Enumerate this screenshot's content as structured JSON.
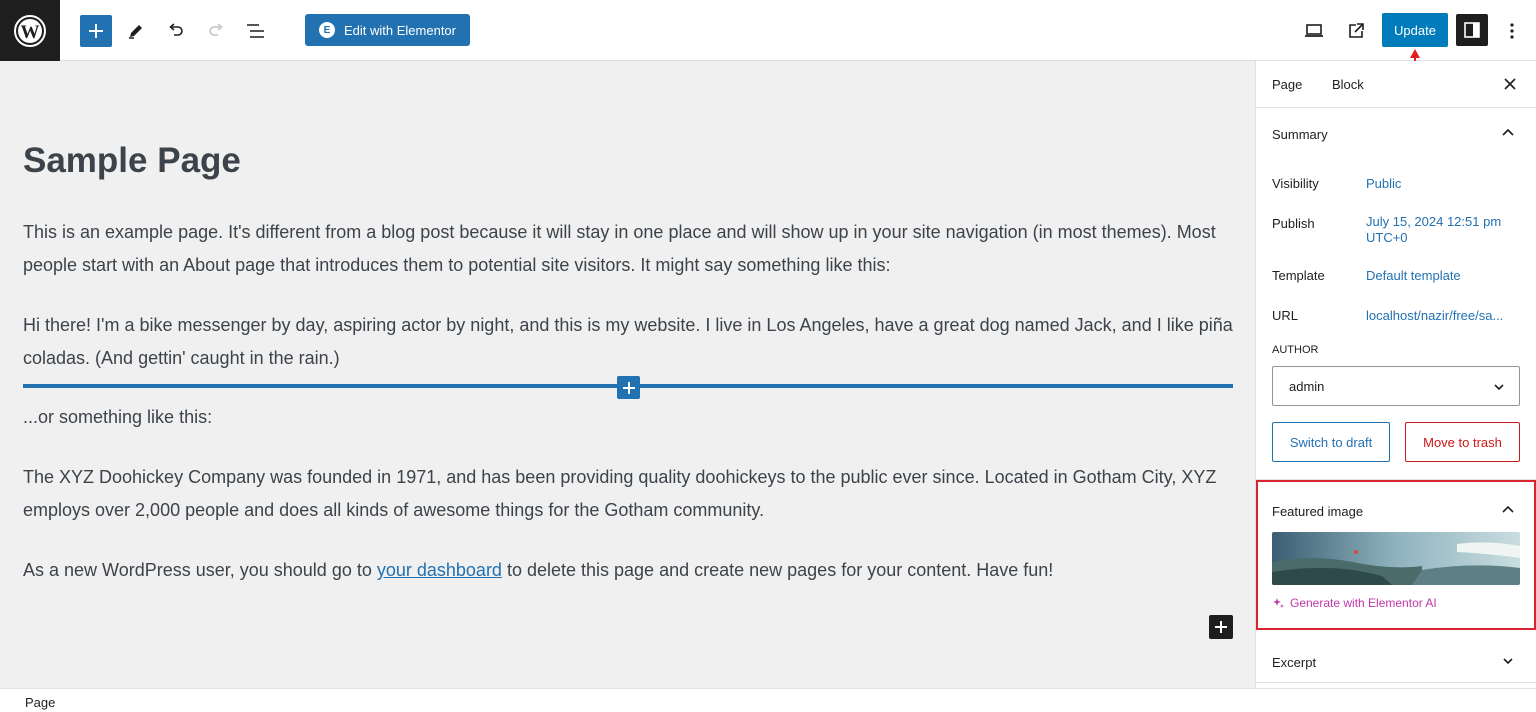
{
  "toolbar": {
    "elementor_label": "Edit with Elementor",
    "update_label": "Update"
  },
  "content": {
    "title": "Sample Page",
    "p1": "This is an example page. It's different from a blog post because it will stay in one place and will show up in your site navigation (in most themes). Most people start with an About page that introduces them to potential site visitors. It might say something like this:",
    "p2": "Hi there! I'm a bike messenger by day, aspiring actor by night, and this is my website. I live in Los Angeles, have a great dog named Jack, and I like piña coladas. (And gettin' caught in the rain.)",
    "p3": "...or something like this:",
    "p4": "The XYZ Doohickey Company was founded in 1971, and has been providing quality doohickeys to the public ever since. Located in Gotham City, XYZ employs over 2,000 people and does all kinds of awesome things for the Gotham community.",
    "p5_before": "As a new WordPress user, you should go to ",
    "p5_link": "your dashboard",
    "p5_after": " to delete this page and create new pages for your content. Have fun!"
  },
  "sidebar": {
    "tabs": [
      "Page",
      "Block"
    ],
    "summary": {
      "title": "Summary",
      "rows": [
        {
          "label": "Visibility",
          "value": "Public"
        },
        {
          "label": "Publish",
          "value": "July 15, 2024 12:51 pm",
          "value2": "UTC+0"
        },
        {
          "label": "Template",
          "value": "Default template"
        },
        {
          "label": "URL",
          "value": "localhost/nazir/free/sa..."
        }
      ],
      "author_label": "AUTHOR",
      "author_value": "admin",
      "switch_draft": "Switch to draft",
      "move_trash": "Move to trash"
    },
    "featured": {
      "title": "Featured image",
      "generate": "Generate with Elementor AI"
    },
    "excerpt": {
      "title": "Excerpt"
    }
  },
  "footer": {
    "breadcrumb": "Page"
  },
  "colors": {
    "accent": "#2271b1",
    "danger": "#cc1818",
    "highlight": "#d9232e",
    "ai": "#c036aa"
  }
}
